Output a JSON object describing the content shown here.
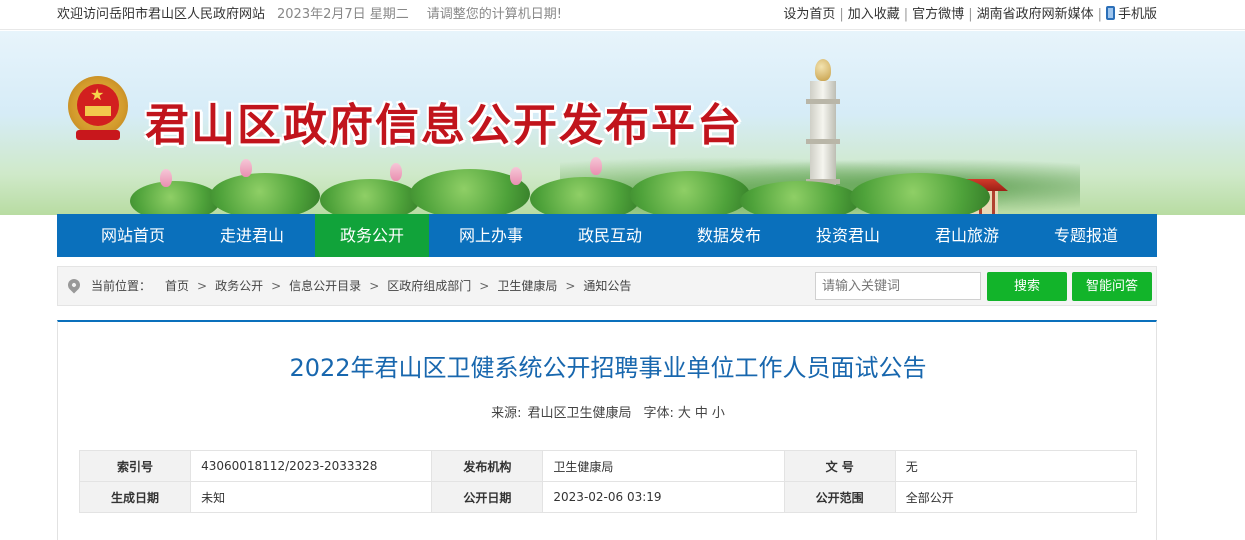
{
  "topbar": {
    "welcome": "欢迎访问岳阳市君山区人民政府网站",
    "date": "2023年2月7日 星期二",
    "hint": "请调整您的计算机日期!",
    "links": [
      "设为首页",
      "加入收藏",
      "官方微博",
      "湖南省政府网新媒体"
    ],
    "mobile": "手机版"
  },
  "banner": {
    "title": "君山区政府信息公开发布平台"
  },
  "nav": {
    "items": [
      "网站首页",
      "走进君山",
      "政务公开",
      "网上办事",
      "政民互动",
      "数据发布",
      "投资君山",
      "君山旅游",
      "专题报道"
    ],
    "active_index": 2
  },
  "breadcrumb": {
    "label": "当前位置：",
    "items": [
      "首页",
      "政务公开",
      "信息公开目录",
      "区政府组成部门",
      "卫生健康局",
      "通知公告"
    ],
    "separator": ">"
  },
  "search": {
    "placeholder": "请输入关键词",
    "search_button": "搜索",
    "ask_button": "智能问答"
  },
  "article": {
    "title": "2022年君山区卫健系统公开招聘事业单位工作人员面试公告",
    "source_label": "来源:",
    "source": "君山区卫生健康局",
    "font_label": "字体:",
    "font_sizes": [
      "大",
      "中",
      "小"
    ]
  },
  "info_table": {
    "rows": [
      [
        {
          "key": "索引号",
          "value": "43060018112/2023-2033328"
        },
        {
          "key": "发布机构",
          "value": "卫生健康局"
        },
        {
          "key": "文 号",
          "value": "无"
        }
      ],
      [
        {
          "key": "生成日期",
          "value": "未知"
        },
        {
          "key": "公开日期",
          "value": "2023-02-06 03:19"
        },
        {
          "key": "公开范围",
          "value": "全部公开"
        }
      ]
    ]
  },
  "colors": {
    "nav_blue": "#0a70bc",
    "nav_active_green": "#11a33a",
    "button_green": "#12b42a",
    "title_red": "#c1141c",
    "article_title_blue": "#1867ae"
  }
}
